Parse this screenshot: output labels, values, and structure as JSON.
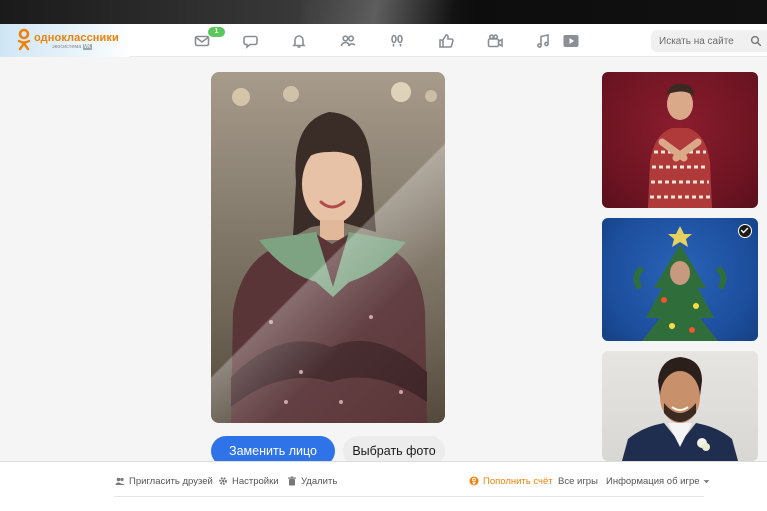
{
  "brand": {
    "name": "одноклассники",
    "subtitle": "экосистема",
    "subtitle_badge": "VK",
    "accent": "#ee8208"
  },
  "header": {
    "messages_badge": "1",
    "nav_icons": [
      "mail-icon",
      "chat-icon",
      "bell-icon",
      "friends-icon",
      "footprints-icon",
      "like-icon",
      "video-icon",
      "music-icon",
      "play-icon"
    ],
    "search": {
      "placeholder": "Искать на сайте",
      "value": ""
    }
  },
  "editor": {
    "replace_face_label": "Заменить лицо",
    "choose_photo_label": "Выбрать фото",
    "primary_color": "#2e74e8"
  },
  "templates": [
    {
      "name": "template-1",
      "selected": false
    },
    {
      "name": "template-2",
      "selected": true
    },
    {
      "name": "template-3",
      "selected": false
    }
  ],
  "footer": {
    "invite_label": "Пригласить друзей",
    "settings_label": "Настройки",
    "delete_label": "Удалить",
    "topup_label": "Пополнить счёт",
    "all_games_label": "Все игры",
    "game_info_label": "Информация об игре"
  }
}
